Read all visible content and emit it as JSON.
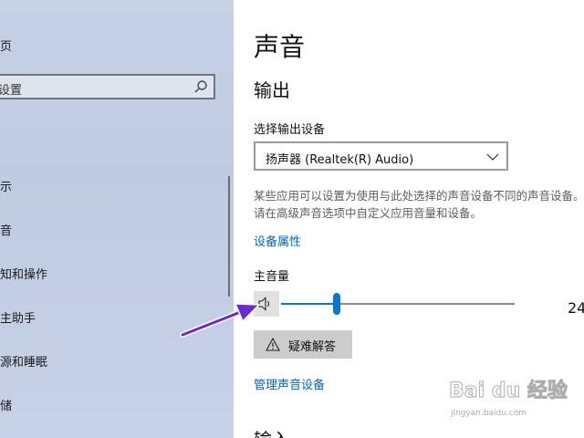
{
  "sidebar": {
    "home_label": "页",
    "search_text": "设置",
    "items": [
      {
        "label": "示"
      },
      {
        "label": "音"
      },
      {
        "label": "知和操作"
      },
      {
        "label": "主助手"
      },
      {
        "label": "源和睡眠"
      },
      {
        "label": "储"
      }
    ]
  },
  "main": {
    "page_title": "声音",
    "output_title": "输出",
    "choose_device_label": "选择输出设备",
    "device_value": "扬声器 (Realtek(R) Audio)",
    "description": "某些应用可以设置为使用与此处选择的声音设备不同的声音设备。请在高级声音选项中自定义应用音量和设备。",
    "device_properties_link": "设备属性",
    "master_volume_label": "主音量",
    "volume_value": "24",
    "volume_level_percent": 24,
    "troubleshoot_label": "疑难解答",
    "manage_devices_link": "管理声音设备",
    "input_title": "输入"
  },
  "watermark": {
    "logo": "Bai du 经验",
    "url": "jingyan.baidu.com"
  },
  "colors": {
    "accent": "#0078d4",
    "link": "#0067c0",
    "arrow": "#6a2bd0"
  }
}
